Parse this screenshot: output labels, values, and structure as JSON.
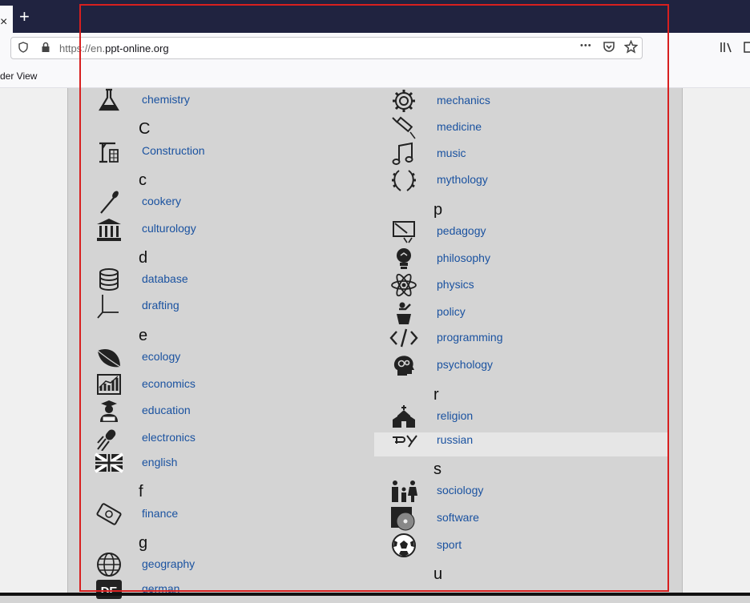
{
  "browser": {
    "close_tab_glyph": "×",
    "new_tab_glyph": "+",
    "url_protocol": "https://en.",
    "url_host": "ppt-online.org",
    "more_glyph": "•••",
    "reader_view_label": "der View"
  },
  "left_column": [
    {
      "kind": "item",
      "label": "chemistry",
      "icon": "flask-icon"
    },
    {
      "kind": "letter",
      "label": "C"
    },
    {
      "kind": "item",
      "label": "Construction",
      "icon": "crane-icon"
    },
    {
      "kind": "letter",
      "label": "c"
    },
    {
      "kind": "item",
      "label": "cookery",
      "icon": "spoon-icon"
    },
    {
      "kind": "item",
      "label": "culturology",
      "icon": "museum-icon"
    },
    {
      "kind": "letter",
      "label": "d"
    },
    {
      "kind": "item",
      "label": "database",
      "icon": "database-icon"
    },
    {
      "kind": "item",
      "label": "drafting",
      "icon": "axes-icon"
    },
    {
      "kind": "letter",
      "label": "e"
    },
    {
      "kind": "item",
      "label": "ecology",
      "icon": "leaf-icon"
    },
    {
      "kind": "item",
      "label": "economics",
      "icon": "chart-icon"
    },
    {
      "kind": "item",
      "label": "education",
      "icon": "student-icon"
    },
    {
      "kind": "item",
      "label": "electronics",
      "icon": "diode-icon"
    },
    {
      "kind": "item",
      "label": "english",
      "icon": "uk-flag-icon"
    },
    {
      "kind": "letter",
      "label": "f"
    },
    {
      "kind": "item",
      "label": "finance",
      "icon": "banknote-icon"
    },
    {
      "kind": "letter",
      "label": "g"
    },
    {
      "kind": "item",
      "label": "geography",
      "icon": "globe-icon"
    },
    {
      "kind": "item",
      "label": "german",
      "icon": "de-icon"
    }
  ],
  "right_column": [
    {
      "kind": "item",
      "label": "mechanics",
      "icon": "gear-icon"
    },
    {
      "kind": "item",
      "label": "medicine",
      "icon": "syringe-icon"
    },
    {
      "kind": "item",
      "label": "music",
      "icon": "music-note-icon"
    },
    {
      "kind": "item",
      "label": "mythology",
      "icon": "laurel-icon"
    },
    {
      "kind": "letter",
      "label": "p"
    },
    {
      "kind": "item",
      "label": "pedagogy",
      "icon": "blackboard-icon"
    },
    {
      "kind": "item",
      "label": "philosophy",
      "icon": "head-bulb-icon"
    },
    {
      "kind": "item",
      "label": "physics",
      "icon": "atom-icon"
    },
    {
      "kind": "item",
      "label": "policy",
      "icon": "speaker-podium-icon"
    },
    {
      "kind": "item",
      "label": "programming",
      "icon": "code-icon"
    },
    {
      "kind": "item",
      "label": "psychology",
      "icon": "head-gears-icon"
    },
    {
      "kind": "letter",
      "label": "r"
    },
    {
      "kind": "item",
      "label": "religion",
      "icon": "church-icon"
    },
    {
      "kind": "item",
      "label": "russian",
      "icon": "ru-letters-icon",
      "highlighted": true
    },
    {
      "kind": "letter",
      "label": "s"
    },
    {
      "kind": "item",
      "label": "sociology",
      "icon": "family-icon"
    },
    {
      "kind": "item",
      "label": "software",
      "icon": "disc-icon"
    },
    {
      "kind": "item",
      "label": "sport",
      "icon": "soccer-ball-icon"
    },
    {
      "kind": "letter",
      "label": "u"
    }
  ],
  "colors": {
    "tab_bar": "#202340",
    "link": "#1a52a0",
    "panel": "#d4d4d4",
    "annotation_box": "#d71f1f"
  }
}
